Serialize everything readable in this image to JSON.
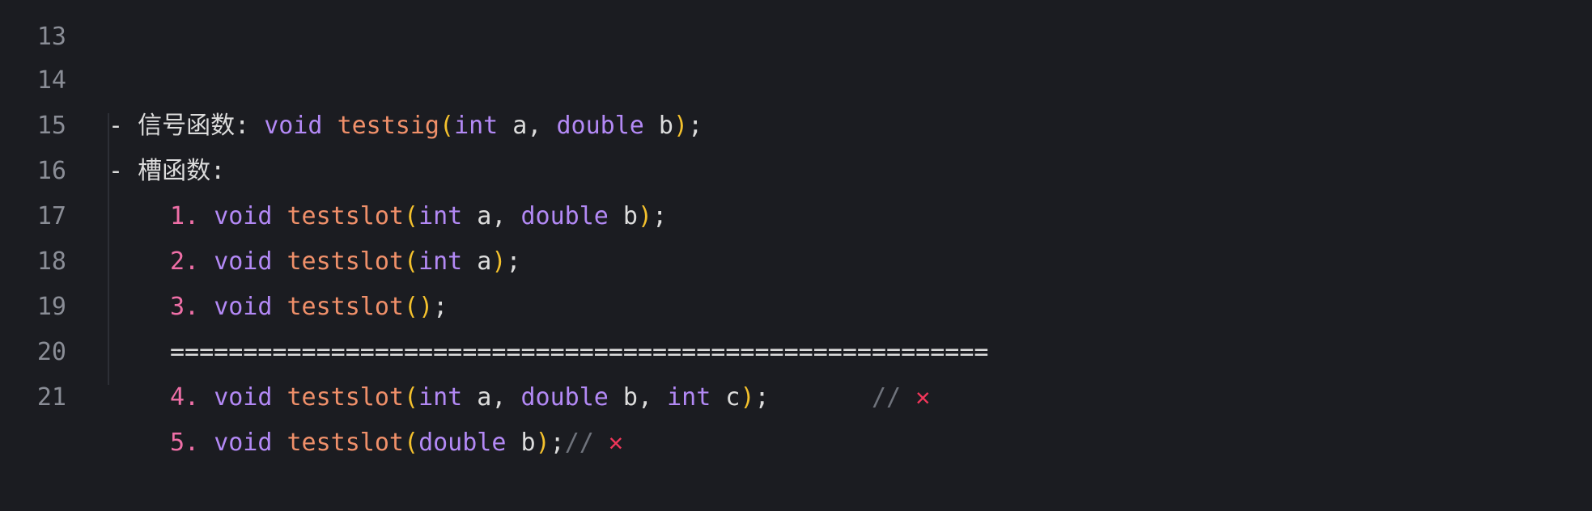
{
  "editor": {
    "lines": [
      {
        "n": "13"
      },
      {
        "n": "14",
        "dash": "- ",
        "label": "信号函数: ",
        "kw1": "void",
        "fn": "testsig",
        "open": "(",
        "t1": "int",
        "p1": " a, ",
        "t2": "double",
        "p2": " b",
        "close": ")",
        "end": ";"
      },
      {
        "n": "15",
        "dash": "- ",
        "label": "槽函数:"
      },
      {
        "n": "16",
        "num": "1. ",
        "kw1": "void",
        "fn": "testslot",
        "open": "(",
        "t1": "int",
        "p1": " a, ",
        "t2": "double",
        "p2": " b",
        "close": ")",
        "end": ";"
      },
      {
        "n": "17",
        "num": "2. ",
        "kw1": "void",
        "fn": "testslot",
        "open": "(",
        "t1": "int",
        "p1": " a",
        "close": ")",
        "end": ";"
      },
      {
        "n": "18",
        "num": "3. ",
        "kw1": "void",
        "fn": "testslot",
        "open": "(",
        "close": ")",
        "end": ";"
      },
      {
        "n": "19",
        "sep": "========================================================"
      },
      {
        "n": "20",
        "num": "4. ",
        "kw1": "void",
        "fn": "testslot",
        "open": "(",
        "t1": "int",
        "p1": " a, ",
        "t2": "double",
        "p2": " b, ",
        "t3": "int",
        "p3": " c",
        "close": ")",
        "end": ";",
        "gap": "       ",
        "comment": "// ",
        "mark": "✕"
      },
      {
        "n": "21",
        "num": "5. ",
        "kw1": "void",
        "fn": "testslot",
        "open": "(",
        "t1": "double",
        "p1": " b",
        "close": ")",
        "end": ";",
        "comment": "// ",
        "mark": "✕"
      }
    ]
  },
  "colors": {
    "background": "#1b1c21",
    "keyword": "#b389f5",
    "function": "#f0906a",
    "bracket": "#f4c12d",
    "list_number": "#ef6fa7",
    "comment": "#6f737c",
    "cross_mark": "#f1365a"
  }
}
